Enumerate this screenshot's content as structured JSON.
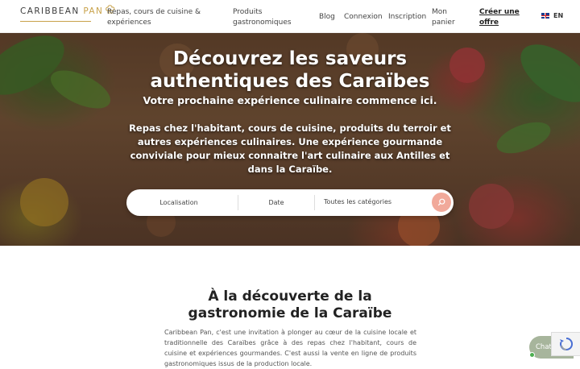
{
  "header": {
    "logo": {
      "text_main": "CARIBBEAN PAN",
      "brand_color": "#c8a24a"
    },
    "nav": [
      {
        "label_line1": "Repas, cours de cuisine &",
        "label_line2": "expériences"
      },
      {
        "label_line1": "Produits",
        "label_line2": "gastronomiques"
      },
      {
        "label_line1": "Blog",
        "label_line2": ""
      },
      {
        "label_line1": "Connexion",
        "label_line2": ""
      },
      {
        "label_line1": "Inscription",
        "label_line2": ""
      },
      {
        "label_line1": "Mon",
        "label_line2": "panier"
      },
      {
        "label_line1": "Créer une",
        "label_line2": "offre"
      }
    ],
    "language": {
      "label": "EN",
      "icon": "uk-flag-icon"
    }
  },
  "hero": {
    "title_line1": "Découvrez les saveurs",
    "title_line2": "authentiques des Caraïbes",
    "subtitle": "Votre prochaine expérience culinaire commence ici.",
    "description": "Repas chez l'habitant, cours de cuisine, produits du terroir et autres expériences culinaires. Une expérience gourmande conviviale pour mieux connaitre l'art culinaire aux Antilles et dans la Caraïbe."
  },
  "search": {
    "location_label": "Localisation",
    "date_label": "Date",
    "category_label": "Toutes les catégories",
    "button_icon": "search-icon",
    "button_color": "#f1a99a"
  },
  "section": {
    "title_line1": "À la découverte de la",
    "title_line2": "gastronomie de la Caraïbe",
    "body": "Caribbean Pan, c'est une invitation à plonger au cœur de la cuisine locale et traditionnelle des Caraïbes grâce à des repas chez l'habitant, cours de cuisine et expériences gourmandes. C'est aussi la vente en ligne de produits gastronomiques issus de la production locale."
  },
  "chat": {
    "label": "Chat",
    "color": "#a7b59c"
  }
}
